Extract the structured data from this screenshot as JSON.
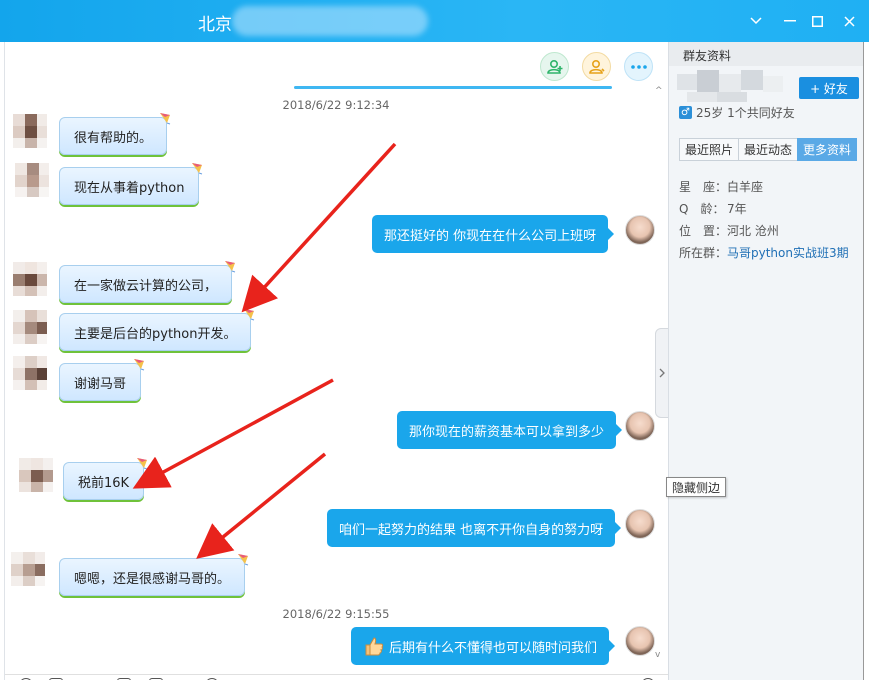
{
  "titlebar": {
    "title": "北京"
  },
  "toolbar": {
    "add_member": "add-user-icon",
    "invite": "invite-icon",
    "more": "more-icon"
  },
  "timestamps": [
    "2018/6/22 9:12:34",
    "2018/6/22 9:15:55"
  ],
  "messages": [
    {
      "dir": "in",
      "text": "很有帮助的。"
    },
    {
      "dir": "in",
      "text": "现在从事着python"
    },
    {
      "dir": "out",
      "text": "那还挺好的 你现在在什么公司上班呀"
    },
    {
      "dir": "in",
      "text": "在一家做云计算的公司，"
    },
    {
      "dir": "in",
      "text": "主要是后台的python开发。"
    },
    {
      "dir": "in",
      "text": "谢谢马哥"
    },
    {
      "dir": "out",
      "text": "那你现在的薪资基本可以拿到多少"
    },
    {
      "dir": "in",
      "text": "税前16K"
    },
    {
      "dir": "out",
      "text": "咱们一起努力的结果 也离不开你自身的努力呀"
    },
    {
      "dir": "in",
      "text": "嗯嗯，还是很感谢马哥的。"
    },
    {
      "dir": "out",
      "text": "后期有什么不懂得也可以随时问我们"
    }
  ],
  "side_panel": {
    "header": "群友资料",
    "add_friend": "+ 好友",
    "age_line": "25岁 1个共同好友",
    "gender_icon": "♂",
    "tabs": [
      "最近照片",
      "最近动态",
      "更多资料"
    ],
    "rows": [
      {
        "key": "星　座：",
        "value": "白羊座"
      },
      {
        "key": "Q　龄：",
        "value": "7年"
      },
      {
        "key": "位　置：",
        "value": "河北 沧州"
      },
      {
        "key": "所在群：",
        "value": "马哥python实战班3期"
      }
    ]
  },
  "tooltip": "隐藏侧边",
  "colors": {
    "accent": "#1aa6eb",
    "titlebar": "#13a5ec",
    "arrow": "#e8231c"
  }
}
